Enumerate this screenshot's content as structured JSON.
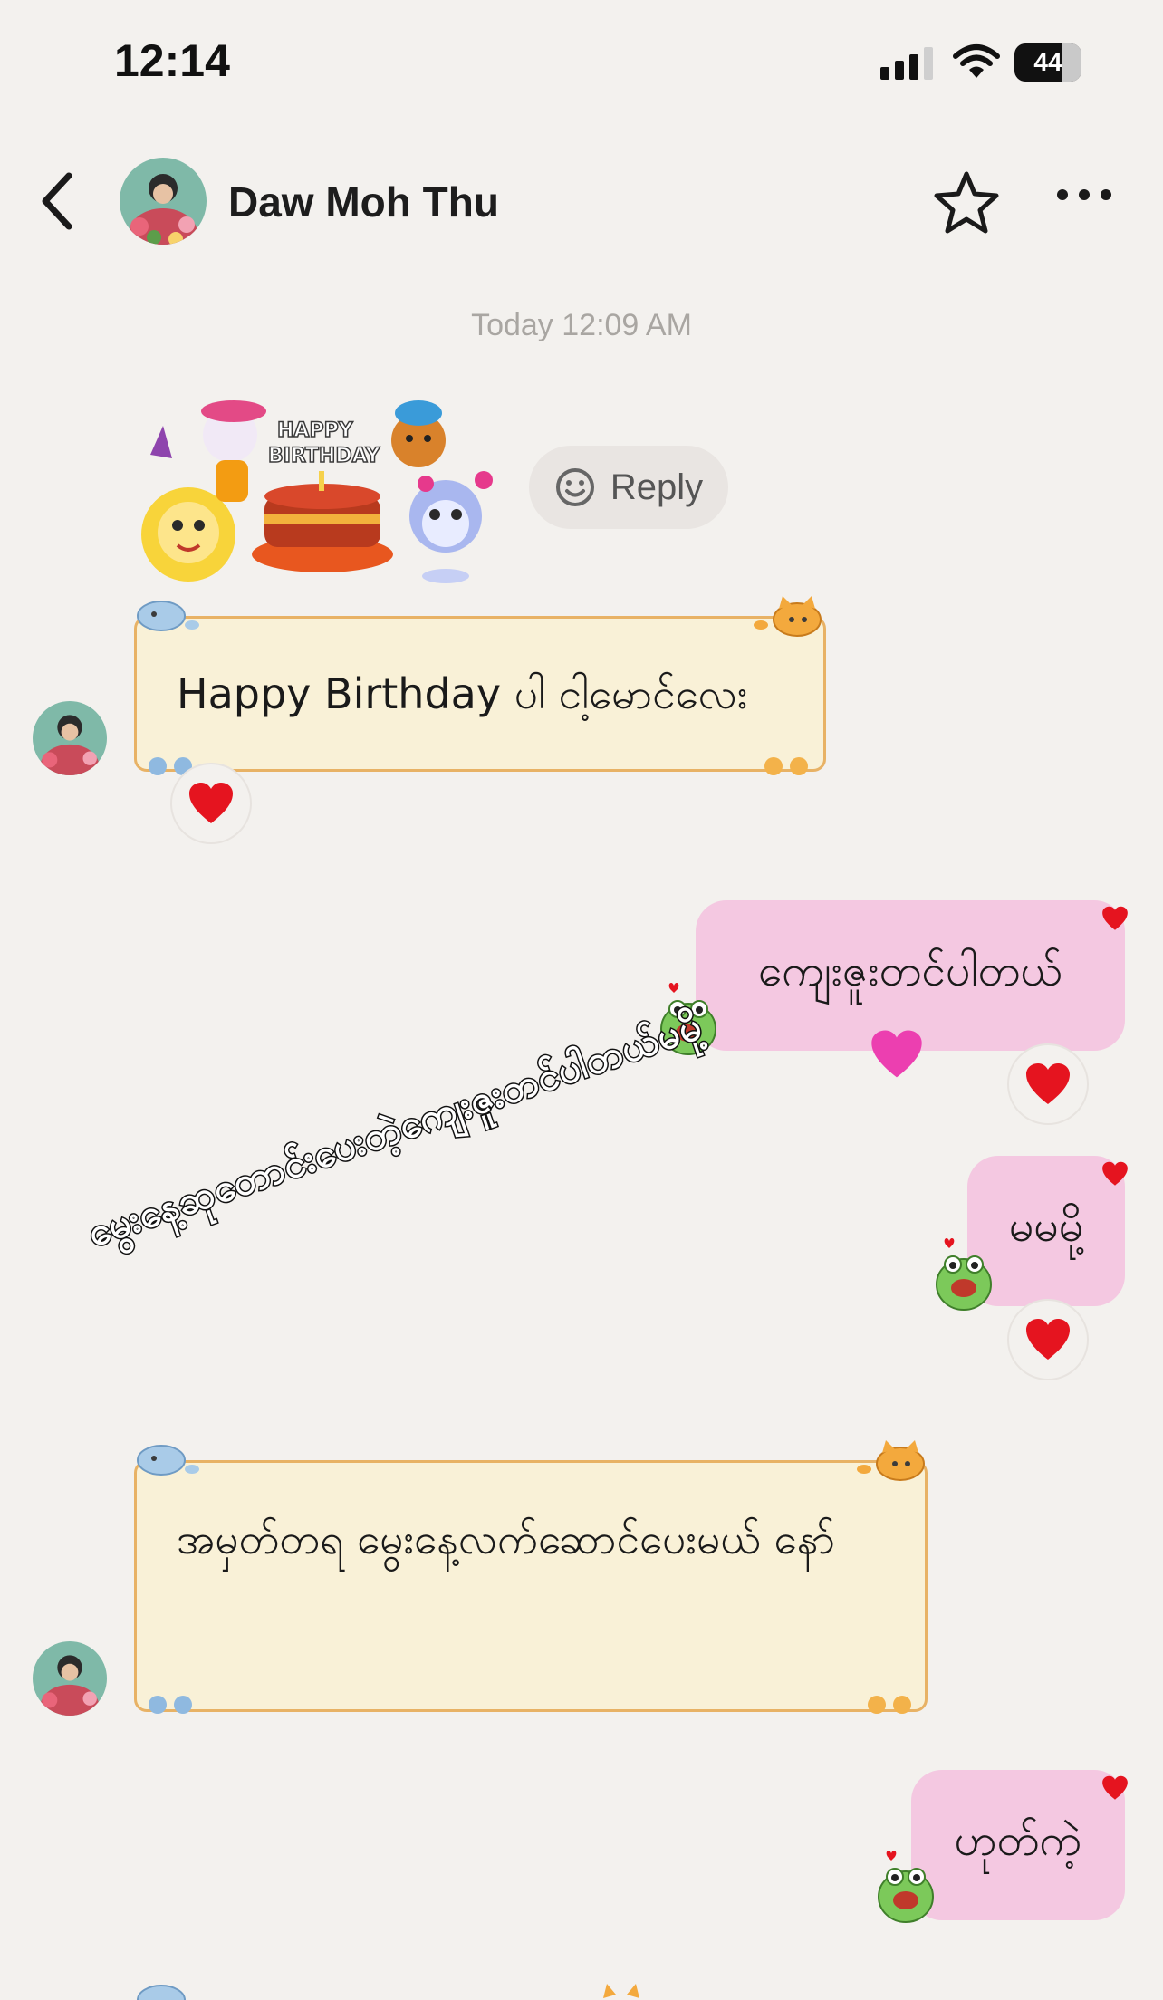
{
  "status_bar": {
    "time": "12:14",
    "battery": "44"
  },
  "header": {
    "contact_name": "Daw Moh Thu"
  },
  "chat": {
    "timestamp": "Today 12:09 AM",
    "reply_label": "Reply",
    "sticker_text": "HAPPY BIRTHDAY",
    "messages": [
      {
        "direction": "in",
        "text": "Happy Birthday ပါ ငါ့မောင်လေး",
        "reaction": "heart"
      },
      {
        "direction": "out",
        "text": "ကျေးဇူးတင်ပါတယ်",
        "reaction": "heart"
      },
      {
        "direction": "out",
        "text": "မမမို့",
        "reaction": "heart"
      },
      {
        "direction": "in",
        "text": "အမှတ်တရ မွေးနေ့လက်ဆောင်ပေးမယ် နော်"
      },
      {
        "direction": "out",
        "text": "ဟုတ်ကဲ့"
      }
    ],
    "overlay_caption": "မွေးနေ့ဆုတောင်းပေးတဲ့ကျေးဇူးတင်ပါတယ်မမို့"
  },
  "colors": {
    "background": "#f3f1ee",
    "incoming_bubble": "#f9f1d7",
    "incoming_border": "#e8b265",
    "outgoing_bubble": "#f4c8e1",
    "heart": "#e5141f"
  }
}
